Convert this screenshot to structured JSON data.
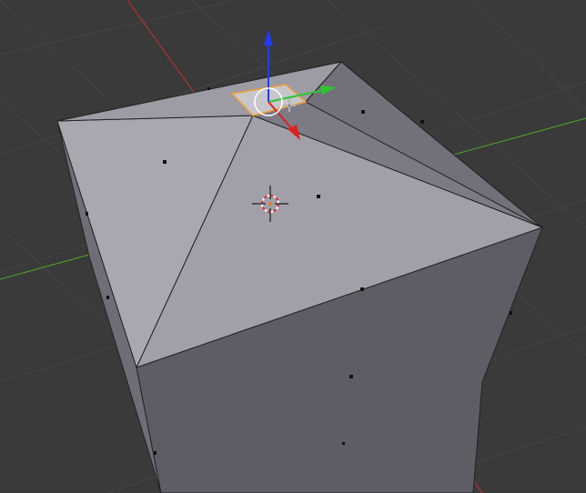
{
  "viewport": {
    "background_color": "#3a3a3a",
    "grid_color": "#444444",
    "x_axis_color": "#c8332e",
    "y_axis_color": "#4fa62a",
    "mesh_face_color": "#a5a4ad",
    "mesh_side_color": "#6d6c75",
    "mesh_front_color": "#5f5e67",
    "selection_color": "#f0a030"
  },
  "gizmo": {
    "z_axis_color": "#1f3cff",
    "y_axis_color": "#2fc42f",
    "x_axis_color": "#e02020"
  },
  "icons": {
    "cursor": "3d-cursor-icon",
    "move": "move-crosshair-icon"
  }
}
